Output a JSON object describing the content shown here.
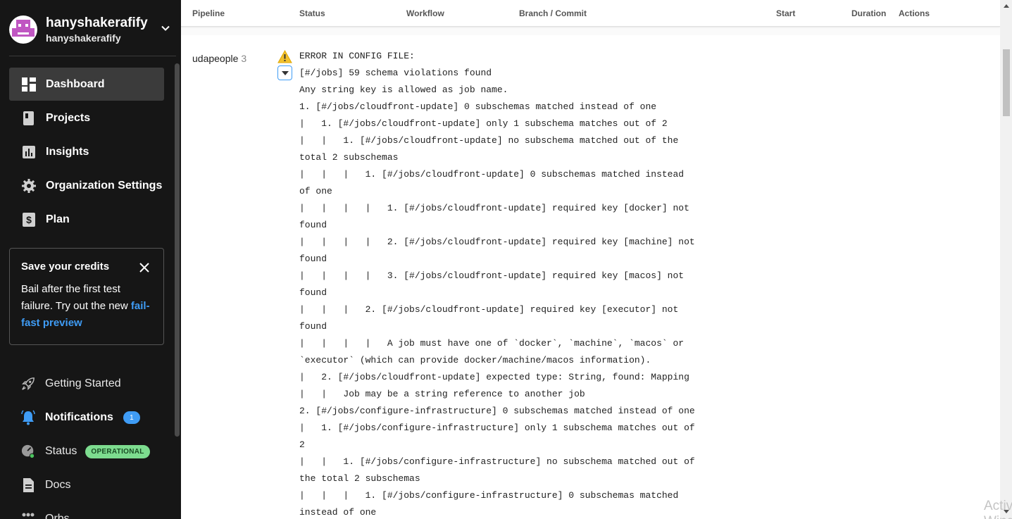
{
  "org": {
    "name": "hanyshakerafify",
    "username": "hanyshakerafify"
  },
  "nav": [
    {
      "label": "Dashboard",
      "icon": "dashboard-icon",
      "active": true
    },
    {
      "label": "Projects",
      "icon": "projects-icon"
    },
    {
      "label": "Insights",
      "icon": "insights-icon"
    },
    {
      "label": "Organization Settings",
      "icon": "gear-icon"
    },
    {
      "label": "Plan",
      "icon": "dollar-icon"
    }
  ],
  "credits": {
    "title": "Save your credits",
    "body": "Bail after the first test failure. Try out the new",
    "link": "fail-fast preview"
  },
  "bottom_nav": {
    "getting_started": "Getting Started",
    "notifications": "Notifications",
    "notifications_count": "1",
    "status": "Status",
    "status_badge": "OPERATIONAL",
    "docs": "Docs",
    "orbs": "Orbs"
  },
  "table_header": {
    "pipeline": "Pipeline",
    "status": "Status",
    "workflow": "Workflow",
    "branch_commit": "Branch / Commit",
    "start": "Start",
    "duration": "Duration",
    "actions": "Actions"
  },
  "pipeline_row": {
    "project": "udapeople",
    "number": "3"
  },
  "error_log": [
    "ERROR IN CONFIG FILE:",
    "[#/jobs] 59 schema violations found",
    "Any string key is allowed as job name.",
    "1. [#/jobs/cloudfront-update] 0 subschemas matched instead of one",
    "|   1. [#/jobs/cloudfront-update] only 1 subschema matches out of 2",
    "|   |   1. [#/jobs/cloudfront-update] no subschema matched out of the",
    "total 2 subschemas",
    "|   |   |   1. [#/jobs/cloudfront-update] 0 subschemas matched instead",
    "of one",
    "|   |   |   |   1. [#/jobs/cloudfront-update] required key [docker] not",
    "found",
    "|   |   |   |   2. [#/jobs/cloudfront-update] required key [machine] not",
    "found",
    "|   |   |   |   3. [#/jobs/cloudfront-update] required key [macos] not",
    "found",
    "|   |   |   2. [#/jobs/cloudfront-update] required key [executor] not",
    "found",
    "|   |   |   |   A job must have one of `docker`, `machine`, `macos` or",
    "`executor` (which can provide docker/machine/macos information).",
    "|   2. [#/jobs/cloudfront-update] expected type: String, found: Mapping",
    "|   |   Job may be a string reference to another job",
    "2. [#/jobs/configure-infrastructure] 0 subschemas matched instead of one",
    "|   1. [#/jobs/configure-infrastructure] only 1 subschema matches out of",
    "2",
    "|   |   1. [#/jobs/configure-infrastructure] no subschema matched out of",
    "the total 2 subschemas",
    "|   |   |   1. [#/jobs/configure-infrastructure] 0 subschemas matched",
    "instead of one"
  ],
  "watermark": "Activate Windows",
  "colors": {
    "sidebar_bg": "#161616",
    "accent": "#3f9cf5",
    "operational": "#7ddc8f",
    "warning": "#f2c12e"
  }
}
